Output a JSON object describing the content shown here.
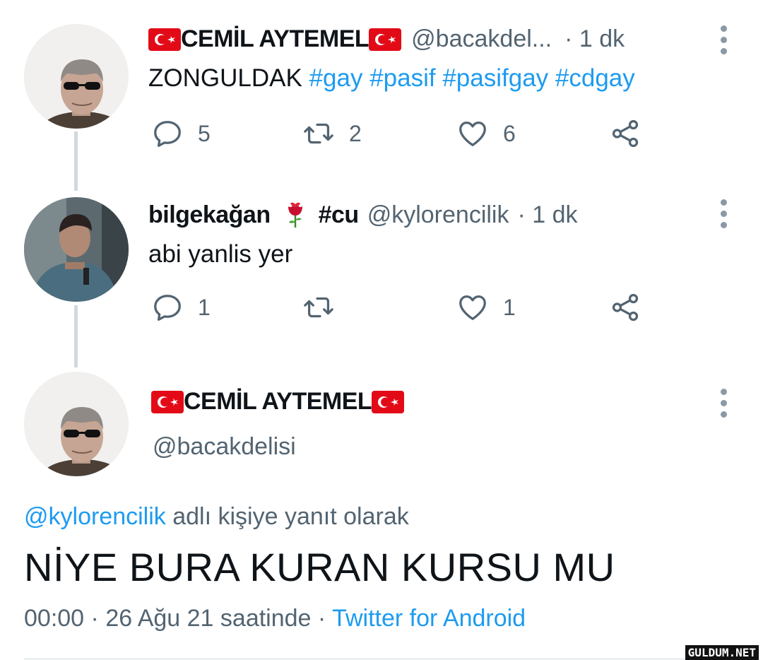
{
  "tweets": [
    {
      "name": "CEMİL AYTEMEL",
      "handle": "@bacakdel...",
      "time": "· 1 dk",
      "text": "ZONGULDAK",
      "hashtags": [
        "#gay",
        "#pasif",
        "#pasifgay",
        "#cdgay"
      ],
      "replies": "5",
      "retweets": "2",
      "likes": "6"
    },
    {
      "name": "bilgekağan",
      "name_suffix": "#cu",
      "handle": "@kylorencilik",
      "time": "· 1 dk",
      "text": "abi yanlis yer",
      "replies": "1",
      "retweets": "",
      "likes": "1"
    }
  ],
  "main_tweet": {
    "name": "CEMİL AYTEMEL",
    "handle": "@bacakdelisi",
    "reply_to_handle": "@kylorencilik",
    "reply_to_text": "adlı kişiye yanıt olarak",
    "text": "NİYE BURA KURAN KURSU MU",
    "time": "00:00",
    "date": "· 26 Ağu 21 saatinde ·",
    "source": "Twitter for Android"
  },
  "watermark": "GULDUM.NET",
  "icons": {
    "reply": "reply-icon",
    "retweet": "retweet-icon",
    "like": "heart-icon",
    "share": "share-icon",
    "more": "more-options-icon",
    "flag": "turkey-flag-icon",
    "rose": "rose-icon"
  },
  "colors": {
    "link": "#1d9bf0",
    "muted": "#536471",
    "flag_red": "#e30a17"
  }
}
